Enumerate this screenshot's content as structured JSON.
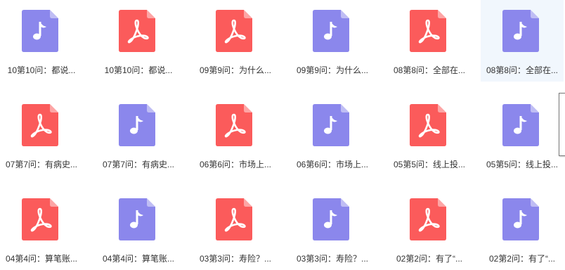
{
  "colors": {
    "audio": "#8b87ec",
    "pdf": "#fb5b5b",
    "selected_bg": "#f1f7fd"
  },
  "files": [
    {
      "name": "10第10问：都说...",
      "type": "audio",
      "icon": "music-note-icon"
    },
    {
      "name": "10第10问：都说...",
      "type": "pdf",
      "icon": "pdf-icon"
    },
    {
      "name": "09第9问：为什么...",
      "type": "pdf",
      "icon": "pdf-icon"
    },
    {
      "name": "09第9问：为什么...",
      "type": "audio",
      "icon": "music-note-icon"
    },
    {
      "name": "08第8问：全部在...",
      "type": "pdf",
      "icon": "pdf-icon"
    },
    {
      "name": "08第8问：全部在...",
      "type": "audio",
      "icon": "music-note-icon",
      "selected": true
    },
    {
      "name": "07第7问：有病史...",
      "type": "pdf",
      "icon": "pdf-icon"
    },
    {
      "name": "07第7问：有病史...",
      "type": "audio",
      "icon": "music-note-icon"
    },
    {
      "name": "06第6问：市场上...",
      "type": "pdf",
      "icon": "pdf-icon"
    },
    {
      "name": "06第6问：市场上...",
      "type": "audio",
      "icon": "music-note-icon"
    },
    {
      "name": "05第5问：线上投...",
      "type": "pdf",
      "icon": "pdf-icon"
    },
    {
      "name": "05第5问：线上投...",
      "type": "audio",
      "icon": "music-note-icon"
    },
    {
      "name": "04第4问：算笔账...",
      "type": "pdf",
      "icon": "pdf-icon"
    },
    {
      "name": "04第4问：算笔账...",
      "type": "audio",
      "icon": "music-note-icon"
    },
    {
      "name": "03第3问：寿险？...",
      "type": "pdf",
      "icon": "pdf-icon"
    },
    {
      "name": "03第3问：寿险？...",
      "type": "audio",
      "icon": "music-note-icon"
    },
    {
      "name": "02第2问：有了“...",
      "type": "pdf",
      "icon": "pdf-icon"
    },
    {
      "name": "02第2问：有了“...",
      "type": "audio",
      "icon": "music-note-icon"
    }
  ]
}
